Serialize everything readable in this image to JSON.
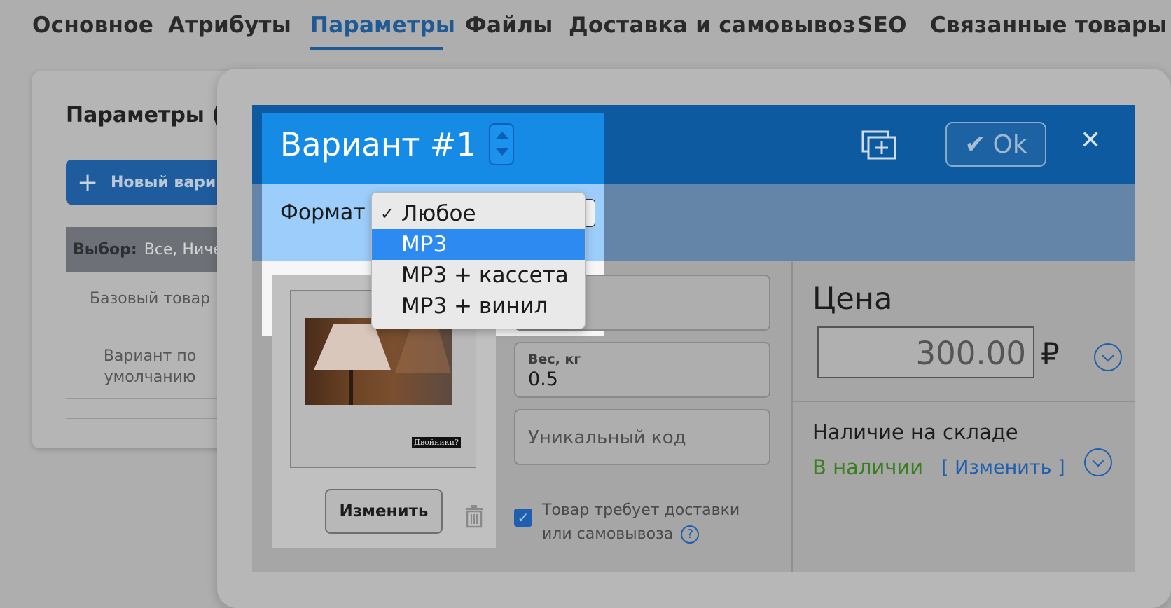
{
  "tabs": [
    {
      "label": "Основное"
    },
    {
      "label": "Атрибуты"
    },
    {
      "label": "Параметры",
      "active": true
    },
    {
      "label": "Файлы"
    },
    {
      "label": "Доставка и самовывоз"
    },
    {
      "label": "SEO"
    },
    {
      "label": "Связанные товары"
    }
  ],
  "background_panel": {
    "title": "Параметры (",
    "new_variant_button": "Новый вари",
    "filter_label": "Выбор:",
    "filter_value": "Все, Ниче",
    "row1": "Базовый товар",
    "row2": "Вариант по умолчанию"
  },
  "modal": {
    "title": "Вариант #1",
    "ok_label": "Ok",
    "format_label": "Формат",
    "format_selected": "Любое",
    "format_options": [
      "Любое",
      "MP3",
      "MP3 + кассета",
      "MP3 + винил"
    ],
    "format_highlighted": "MP3",
    "image_caption": "Двойники?",
    "change_image_button": "Изменить",
    "weight_label": "Вес, кг",
    "weight_value": "0.5",
    "unique_code_placeholder": "Уникальный код",
    "shipping_checkbox_label": "Товар требует доставки или самовывоза",
    "shipping_checked": true,
    "help_icon_glyph": "?",
    "price_title": "Цена",
    "price_value": "300.00",
    "currency": "₽",
    "stock_title": "Наличие на складе",
    "stock_status": "В наличии",
    "stock_change_link": "[ Изменить ]"
  },
  "colors": {
    "accent_blue": "#0e5aa1",
    "highlight_blue": "#168be6",
    "selected_option": "#2d8af0",
    "in_stock_green": "#3a7f1f"
  }
}
